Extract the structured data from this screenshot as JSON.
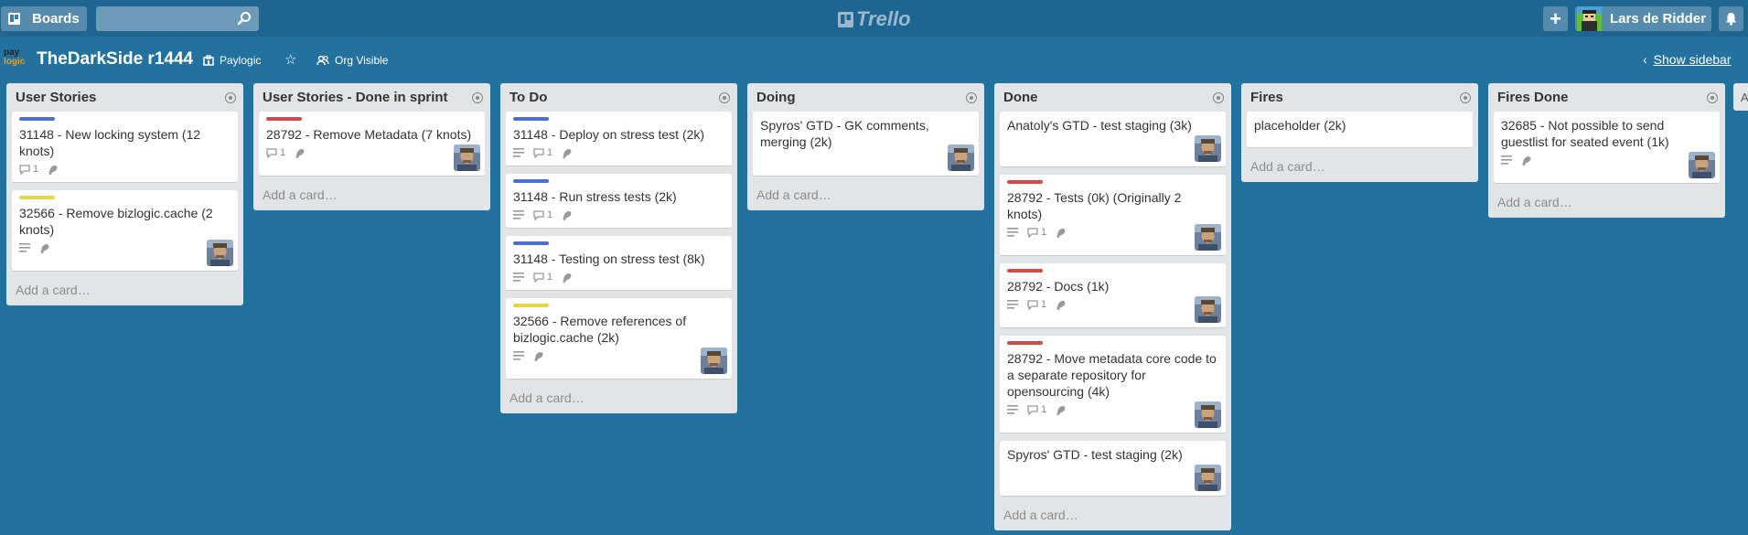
{
  "header": {
    "boards_label": "Boards",
    "logo_text": "Trello",
    "user_name": "Lars de Ridder"
  },
  "board": {
    "org_logo_top": "pay",
    "org_logo_bottom": "logic",
    "title": "TheDarkSide r1444",
    "org_name": "Paylogic",
    "visibility": "Org Visible",
    "show_sidebar": "Show sidebar"
  },
  "colors": {
    "blue_label": "#4a72cf",
    "red_label": "#d24b48",
    "yellow_label": "#e6d54a"
  },
  "lists": [
    {
      "title": "User Stories",
      "add_card": "Add a card…",
      "cards": [
        {
          "label": "blue",
          "title": "31148 - New locking system (12 knots)",
          "description": false,
          "comments": "1",
          "subscribed": true,
          "member": false
        },
        {
          "label": "yellow",
          "title": "32566 - Remove bizlogic.cache (2 knots)",
          "description": true,
          "comments": "",
          "subscribed": true,
          "member": true
        }
      ]
    },
    {
      "title": "User Stories - Done in sprint",
      "add_card": "Add a card…",
      "cards": [
        {
          "label": "red",
          "title": "28792 - Remove Metadata (7 knots)",
          "description": false,
          "comments": "1",
          "subscribed": true,
          "member": true
        }
      ]
    },
    {
      "title": "To Do",
      "add_card": "Add a card…",
      "cards": [
        {
          "label": "blue",
          "title": "31148 - Deploy on stress test (2k)",
          "description": true,
          "comments": "1",
          "subscribed": true,
          "member": false
        },
        {
          "label": "blue",
          "title": "31148 - Run stress tests (2k)",
          "description": true,
          "comments": "1",
          "subscribed": true,
          "member": false
        },
        {
          "label": "blue",
          "title": "31148 - Testing on stress test (8k)",
          "description": true,
          "comments": "1",
          "subscribed": true,
          "member": false
        },
        {
          "label": "yellow",
          "title": "32566 - Remove references of bizlogic.cache (2k)",
          "description": true,
          "comments": "",
          "subscribed": true,
          "member": true
        }
      ]
    },
    {
      "title": "Doing",
      "add_card": "Add a card…",
      "cards": [
        {
          "label": "",
          "title": "Spyros' GTD - GK comments, merging (2k)",
          "description": false,
          "comments": "",
          "subscribed": false,
          "member": true
        }
      ]
    },
    {
      "title": "Done",
      "add_card": "Add a card…",
      "cards": [
        {
          "label": "",
          "title": "Anatoly's GTD - test staging (3k)",
          "description": false,
          "comments": "",
          "subscribed": false,
          "member": true
        },
        {
          "label": "red",
          "title": "28792 - Tests (0k) (Originally 2 knots)",
          "description": true,
          "comments": "1",
          "subscribed": true,
          "member": true
        },
        {
          "label": "red",
          "title": "28792 - Docs (1k)",
          "description": true,
          "comments": "1",
          "subscribed": true,
          "member": true
        },
        {
          "label": "red",
          "title": "28792 - Move metadata core code to a separate repository for opensourcing (4k)",
          "description": true,
          "comments": "1",
          "subscribed": true,
          "member": true
        },
        {
          "label": "",
          "title": "Spyros' GTD - test staging (2k)",
          "description": false,
          "comments": "",
          "subscribed": false,
          "member": true
        }
      ]
    },
    {
      "title": "Fires",
      "add_card": "Add a card…",
      "cards": [
        {
          "label": "",
          "title": "placeholder (2k)",
          "description": false,
          "comments": "",
          "subscribed": false,
          "member": false
        }
      ]
    },
    {
      "title": "Fires Done",
      "add_card": "Add a card…",
      "cards": [
        {
          "label": "",
          "title": "32685 - Not possible to send guestlist for seated event (1k)",
          "description": true,
          "comments": "",
          "subscribed": true,
          "member": true
        }
      ]
    }
  ],
  "edge_list_initial": "A"
}
